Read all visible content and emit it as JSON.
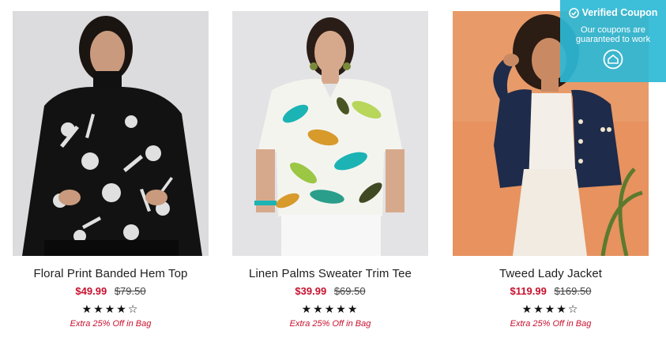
{
  "products": [
    {
      "name": "Floral Print Banded Hem Top",
      "sale_price": "$49.99",
      "original_price": "$79.50",
      "rating": 4,
      "rating_max": 5,
      "promo": "Extra 25% Off in Bag"
    },
    {
      "name": "Linen Palms Sweater Trim Tee",
      "sale_price": "$39.99",
      "original_price": "$69.50",
      "rating": 5,
      "rating_max": 5,
      "promo": "Extra 25% Off in Bag"
    },
    {
      "name": "Tweed Lady Jacket",
      "sale_price": "$119.99",
      "original_price": "$169.50",
      "rating": 4,
      "rating_max": 5,
      "promo": "Extra 25% Off in Bag"
    }
  ],
  "coupon_badge": {
    "title": "Verified Coupon",
    "subtitle_line1": "Our coupons are",
    "subtitle_line2": "guaranteed to work",
    "icon": "home-icon",
    "check_icon": "check-circle-icon"
  },
  "colors": {
    "sale": "#c8102e",
    "coupon_bg": "#2cb8d6"
  }
}
